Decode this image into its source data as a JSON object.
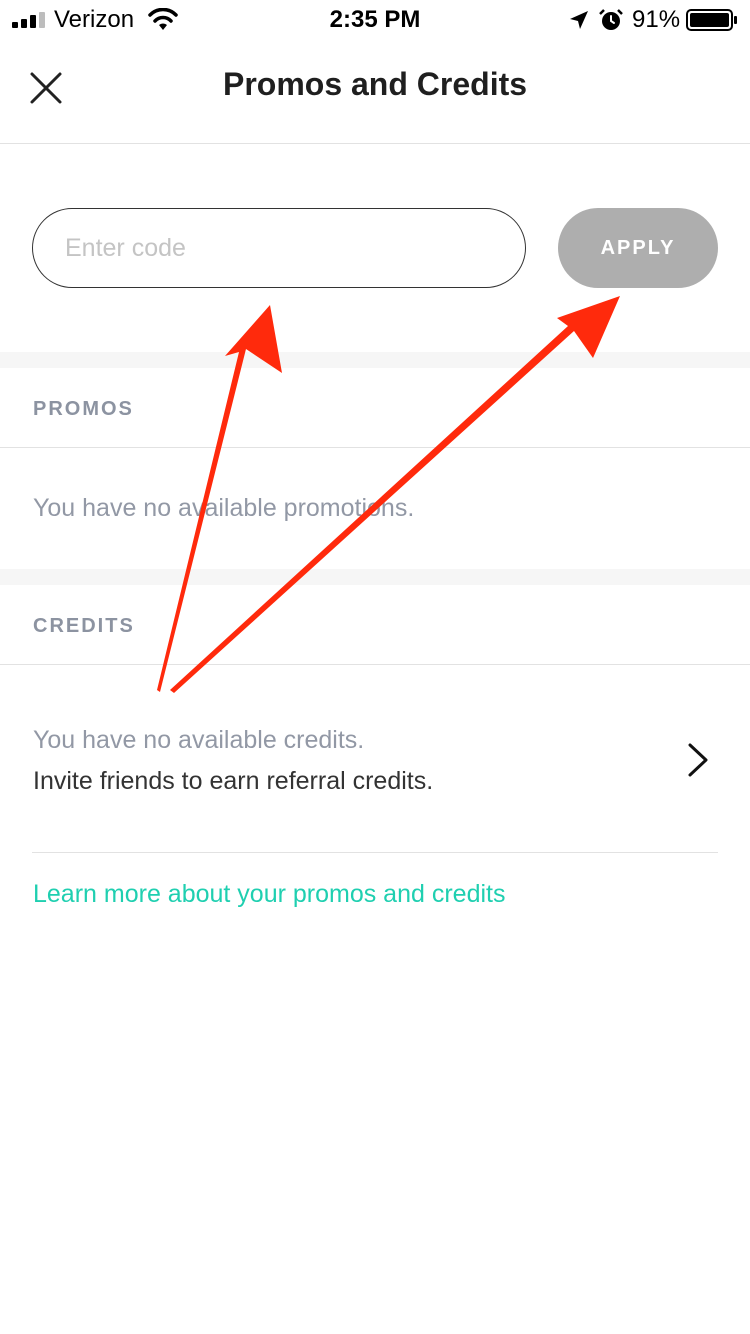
{
  "status_bar": {
    "carrier": "Verizon",
    "time": "2:35 PM",
    "battery_percent": "91%",
    "icons": [
      "signal-icon",
      "wifi-icon",
      "location-icon",
      "alarm-icon",
      "battery-icon"
    ]
  },
  "nav": {
    "title": "Promos and Credits",
    "close_icon": "close-icon"
  },
  "code_entry": {
    "placeholder": "Enter code",
    "value": "",
    "apply_label": "APPLY"
  },
  "promos": {
    "header": "PROMOS",
    "empty_message": "You have no available promotions."
  },
  "credits": {
    "header": "CREDITS",
    "empty_message": "You have no available credits.",
    "invite_message": "Invite friends to earn referral credits.",
    "chevron_icon": "chevron-right-icon"
  },
  "footer": {
    "learn_more_link": "Learn more about your promos and credits"
  },
  "colors": {
    "link": "#1fcfb0",
    "apply_disabled": "#aeaeae",
    "section_header": "#8c93a1",
    "muted_text": "#9298a5",
    "annotation_arrow": "#ff2a0c"
  }
}
